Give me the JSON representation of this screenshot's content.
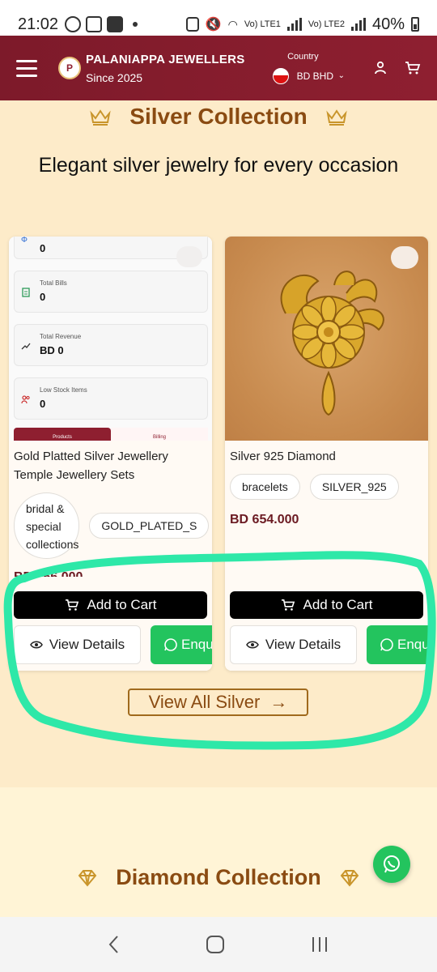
{
  "status_bar": {
    "time": "21:02",
    "net1": "Vo) LTE1",
    "net2": "Vo) LTE2",
    "battery": "40%"
  },
  "header": {
    "brand_name": "PALANIAPPA JEWELLERS",
    "brand_since": "Since 2025",
    "logo_letter": "P",
    "country_label": "Country",
    "country_value": "BD BHD"
  },
  "section": {
    "title": "Silver Collection",
    "subtitle": "Elegant silver jewelry for every occasion"
  },
  "products": [
    {
      "preview_stats": [
        {
          "label": "",
          "value": "0"
        },
        {
          "label": "Total Bills",
          "value": "0"
        },
        {
          "label": "Total Revenue",
          "value": "BD 0"
        },
        {
          "label": "Low Stock Items",
          "value": "0"
        }
      ],
      "preview_tabs": [
        "Products",
        "Billing"
      ],
      "title": "Gold Platted Silver Jewellery Temple Jewellery Sets",
      "tags": [
        "bridal & special collections",
        "GOLD_PLATED_S"
      ],
      "price": "BD 966.000",
      "add_to_cart": "Add to Cart",
      "view_details": "View Details",
      "enquire": "Enqu"
    },
    {
      "title": "Silver 925 Diamond",
      "tags": [
        "bracelets",
        "SILVER_925"
      ],
      "price": "BD 654.000",
      "add_to_cart": "Add to Cart",
      "view_details": "View Details",
      "enquire": "Enqu"
    }
  ],
  "view_all": "View All Silver",
  "diamond_section": {
    "title": "Diamond Collection"
  },
  "colors": {
    "header": "#8e1f30",
    "accent": "#8a4b12",
    "whatsapp": "#23c45e",
    "highlight": "#2ee8a8"
  }
}
